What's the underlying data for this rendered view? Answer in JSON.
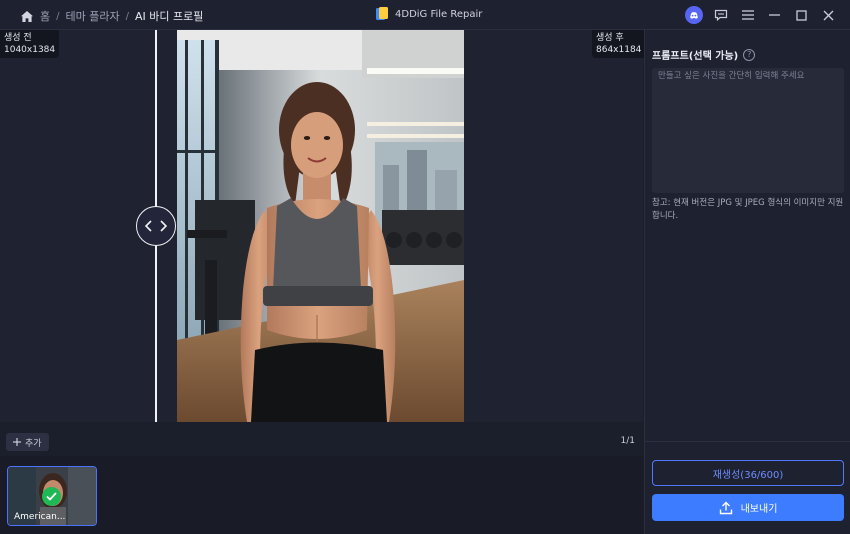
{
  "breadcrumb": {
    "home": "홈",
    "level1": "테마 플라자",
    "current": "AI 바디 프로필",
    "separator": "/"
  },
  "app": {
    "title": "4DDiG File Repair"
  },
  "icons": {
    "home": "home-icon",
    "logo": "app-logo-icon",
    "discord": "discord-icon",
    "feedback": "feedback-icon",
    "menu": "menu-icon",
    "minimize": "minimize-icon",
    "maximize": "maximize-icon",
    "close": "close-icon",
    "compare_handle": "compare-handle-icon",
    "plus": "plus-icon",
    "check": "check-icon",
    "upload": "upload-icon",
    "help": "help-icon"
  },
  "compare": {
    "before_label": "생성 전",
    "before_size": "1040x1384",
    "after_label": "생성 후",
    "after_size": "864x1184",
    "split_position": 0.24
  },
  "toolbar": {
    "add_label": "추가",
    "page_count": "1/1"
  },
  "thumbnails": [
    {
      "name": "American...",
      "selected": true,
      "done": true
    }
  ],
  "panel": {
    "prompt_title": "프롬프트(선택 가능)",
    "help_glyph": "?",
    "prompt_placeholder": "만들고 싶은 사진을 간단히 입력해 주세요",
    "prompt_value": "",
    "note": "참고: 현재 버전은 JPG 및 JPEG 형식의 이미지만 지원합니다.",
    "regenerate_label": "재생성(36/600)",
    "export_label": "내보내기"
  },
  "colors": {
    "background": "#1b1e2b",
    "panel": "#1e2130",
    "accent": "#3d7bff",
    "accent_outline": "#4f78ff",
    "success": "#1eb855",
    "discord": "#5865f2"
  }
}
